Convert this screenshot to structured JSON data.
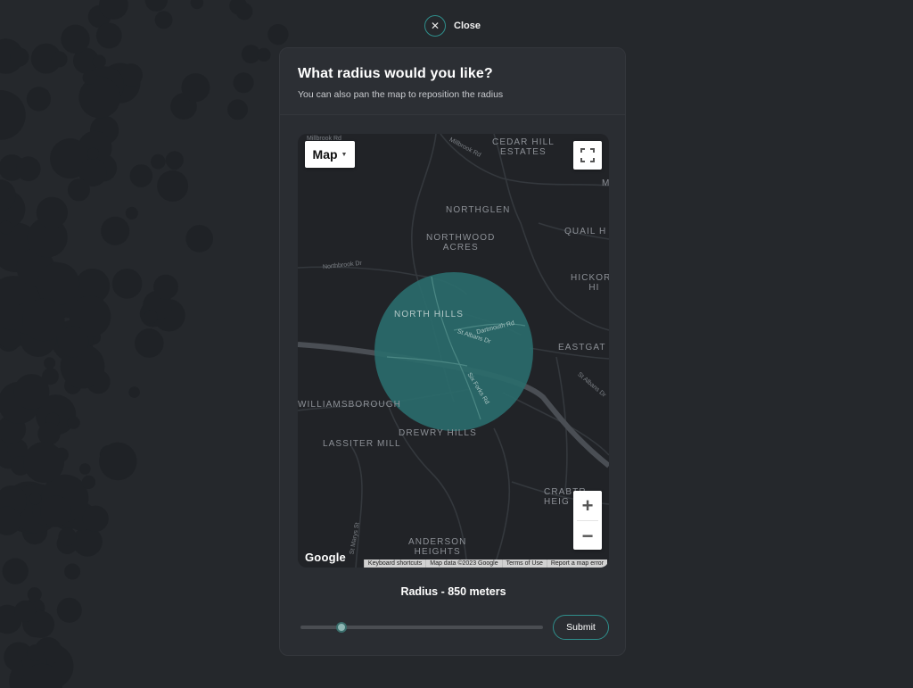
{
  "close": {
    "label": "Close",
    "icon": "close-icon"
  },
  "modal": {
    "title": "What radius would you like?",
    "subtitle": "You can also pan the map to reposition the radius"
  },
  "map": {
    "type_button": "Map",
    "areas": {
      "cedar_hill": "CEDAR HILL\nESTATES",
      "northglen": "NORTHGLEN",
      "northwood": "NORTHWOOD\nACRES",
      "quail": "QUAIL H",
      "hickory": "HICKORY HI",
      "north_hills": "NORTH HILLS",
      "eastgate": "EASTGAT",
      "williamsborough": "WILLIAMSBOROUGH",
      "drewry": "DREWRY HILLS",
      "lassiter": "LASSITER MILL",
      "crabtree": "CRABTR\nHEIG",
      "anderson": "ANDERSON\nHEIGHTS",
      "edge_m": "M"
    },
    "roads": {
      "millbrook": "Millbrook Rd",
      "millbrook_top": "Millbrook Rd",
      "northbrook": "Northbrook Dr",
      "dartmouth": "Dartmouth Rd",
      "st_albans": "St Albans Dr",
      "st_albans_east": "St Albans Dr",
      "six_forks": "Six Forks Rd",
      "st_marys": "St Marys St"
    },
    "google": "Google",
    "attribution": [
      "Keyboard shortcuts",
      "Map data ©2023 Google",
      "Terms of Use",
      "Report a map error"
    ],
    "circle_color": "#2a6b6b"
  },
  "radius": {
    "label": "Radius - 850 meters",
    "value_meters": 850,
    "slider_fraction": 0.17
  },
  "submit": {
    "label": "Submit"
  },
  "colors": {
    "accent": "#2f8f8c",
    "background": "#25282c",
    "modal": "#2a2d32"
  }
}
